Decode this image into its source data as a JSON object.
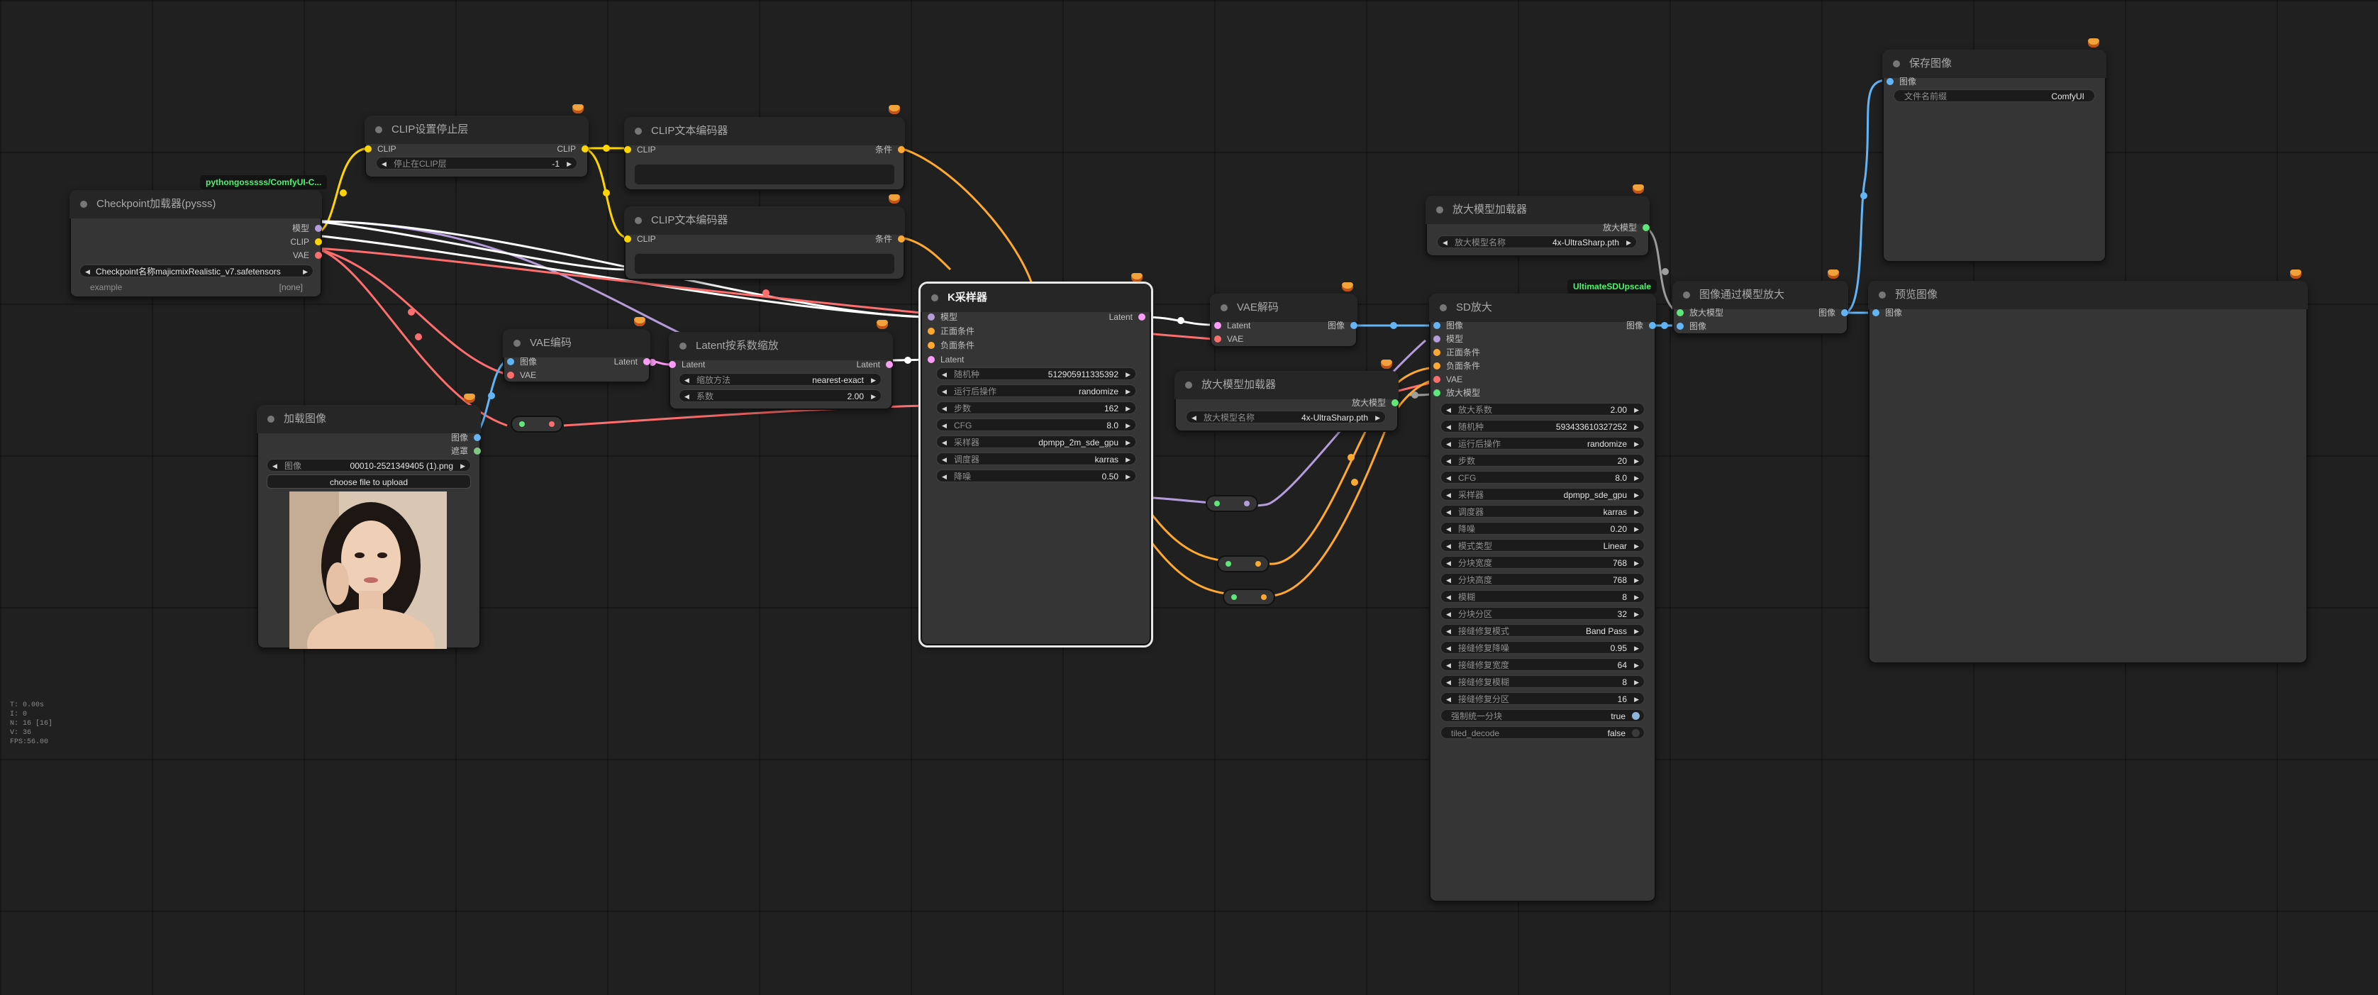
{
  "colors": {
    "clip": "#ffd500",
    "model": "#b39ddb",
    "vae": "#ff6e6e",
    "latent": "#ff9cf9",
    "conditioning": "#ffa931",
    "image": "#64b5f6",
    "upscale_model": "#5ee87a",
    "mask": "#81c784",
    "white_link": "#ffffff"
  },
  "nodes": {
    "checkpoint": {
      "badge": "pythongosssss/ComfyUI-C...",
      "title": "Checkpoint加载器(pysss)",
      "outputs": [
        "模型",
        "CLIP",
        "VAE"
      ],
      "ckpt_value": "Checkpoint名称majicmixRealistic_v7.safetensors",
      "example_label": "example",
      "example_value": "[none]"
    },
    "clip_skip": {
      "title": "CLIP设置停止层",
      "input": "CLIP",
      "output": "CLIP",
      "widget_label": "停止在CLIP层",
      "widget_value": "-1"
    },
    "clip_text1": {
      "title": "CLIP文本编码器",
      "input": "CLIP",
      "output": "条件"
    },
    "clip_text2": {
      "title": "CLIP文本编码器",
      "input": "CLIP",
      "output": "条件"
    },
    "vae_encode": {
      "title": "VAE编码",
      "inputs": [
        "图像",
        "VAE"
      ],
      "output": "Latent"
    },
    "latent_scale": {
      "title": "Latent按系数缩放",
      "input": "Latent",
      "output": "Latent",
      "widgets": [
        {
          "label": "缩放方法",
          "value": "nearest-exact"
        },
        {
          "label": "系数",
          "value": "2.00"
        }
      ]
    },
    "load_image": {
      "title": "加载图像",
      "outputs": [
        "图像",
        "遮罩"
      ],
      "widget_label": "图像",
      "widget_value": "00010-2521349405 (1).png",
      "upload_label": "choose file to upload"
    },
    "ksampler": {
      "title": "K采样器",
      "inputs": [
        "模型",
        "正面条件",
        "负面条件",
        "Latent"
      ],
      "output": "Latent",
      "widgets": [
        {
          "label": "随机种",
          "value": "512905911335392"
        },
        {
          "label": "运行后操作",
          "value": "randomize"
        },
        {
          "label": "步数",
          "value": "162"
        },
        {
          "label": "CFG",
          "value": "8.0"
        },
        {
          "label": "采样器",
          "value": "dpmpp_2m_sde_gpu"
        },
        {
          "label": "调度器",
          "value": "karras"
        },
        {
          "label": "降噪",
          "value": "0.50"
        }
      ]
    },
    "vae_decode": {
      "title": "VAE解码",
      "inputs": [
        "Latent",
        "VAE"
      ],
      "output": "图像"
    },
    "upscale_loader1": {
      "title": "放大模型加载器",
      "output": "放大模型",
      "widget_label": "放大模型名称",
      "widget_value": "4x-UltraSharp.pth"
    },
    "upscale_loader2": {
      "title": "放大模型加载器",
      "output": "放大模型",
      "widget_label": "放大模型名称",
      "widget_value": "4x-UltraSharp.pth"
    },
    "sd_upscale": {
      "badge": "UltimateSDUpscale",
      "title": "SD放大",
      "inputs": [
        "图像",
        "模型",
        "正面条件",
        "负面条件",
        "VAE",
        "放大模型"
      ],
      "output": "图像",
      "widgets": [
        {
          "label": "放大系数",
          "value": "2.00"
        },
        {
          "label": "随机种",
          "value": "593433610327252"
        },
        {
          "label": "运行后操作",
          "value": "randomize"
        },
        {
          "label": "步数",
          "value": "20"
        },
        {
          "label": "CFG",
          "value": "8.0"
        },
        {
          "label": "采样器",
          "value": "dpmpp_sde_gpu"
        },
        {
          "label": "调度器",
          "value": "karras"
        },
        {
          "label": "降噪",
          "value": "0.20"
        },
        {
          "label": "模式类型",
          "value": "Linear"
        },
        {
          "label": "分块宽度",
          "value": "768"
        },
        {
          "label": "分块高度",
          "value": "768"
        },
        {
          "label": "模糊",
          "value": "8"
        },
        {
          "label": "分块分区",
          "value": "32"
        },
        {
          "label": "接缝修复模式",
          "value": "Band Pass"
        },
        {
          "label": "接缝修复降噪",
          "value": "0.95"
        },
        {
          "label": "接缝修复宽度",
          "value": "64"
        },
        {
          "label": "接缝修复模糊",
          "value": "8"
        },
        {
          "label": "接缝修复分区",
          "value": "16"
        }
      ],
      "toggles": [
        {
          "label": "强制统一分块",
          "value": "true"
        },
        {
          "label": "tiled_decode",
          "value": "false"
        }
      ]
    },
    "image_upscale": {
      "title": "图像通过模型放大",
      "inputs": [
        "放大模型",
        "图像"
      ],
      "output": "图像"
    },
    "save_image": {
      "title": "保存图像",
      "input": "图像",
      "widget_label": "文件名前缀",
      "widget_value": "ComfyUI"
    },
    "preview_image": {
      "title": "预览图像",
      "input": "图像"
    }
  },
  "stats": [
    "T: 0.00s",
    "I: 0",
    "N: 16 [16]",
    "V: 36",
    "FPS:56.00"
  ]
}
